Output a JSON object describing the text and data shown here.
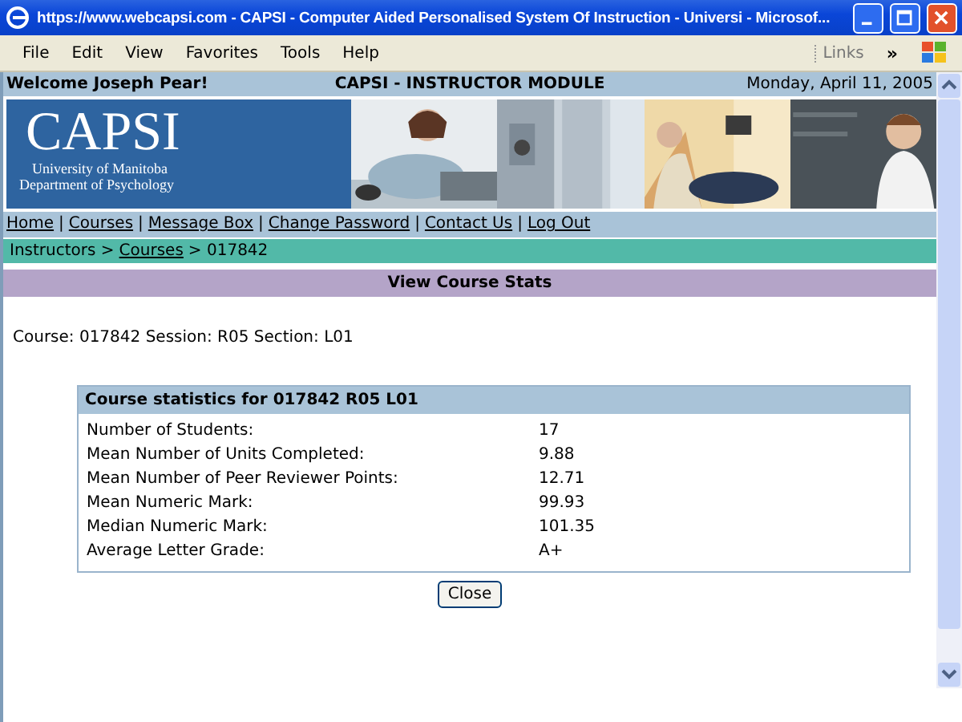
{
  "window": {
    "title": "https://www.webcapsi.com - CAPSI - Computer Aided Personalised System Of Instruction - Universi - Microsof..."
  },
  "menu": [
    "File",
    "Edit",
    "View",
    "Favorites",
    "Tools",
    "Help"
  ],
  "links_toolbar": {
    "label": "Links",
    "chevron": "»"
  },
  "header": {
    "welcome": "Welcome Joseph Pear!",
    "module": "CAPSI - INSTRUCTOR MODULE",
    "date": "Monday, April 11, 2005"
  },
  "banner": {
    "logo": "CAPSI",
    "university": "University of Manitoba",
    "department": "Department of Psychology"
  },
  "nav": {
    "separator": "|",
    "links": [
      "Home",
      "Courses",
      "Message Box",
      "Change Password",
      "Contact Us",
      "Log Out"
    ]
  },
  "breadcrumb": [
    {
      "kind": "text",
      "text": "Instructors >"
    },
    {
      "kind": "link",
      "text": "Courses"
    },
    {
      "kind": "text",
      "text": "> 017842"
    }
  ],
  "section_title": "View Course Stats",
  "course_line": "Course: 017842 Session: R05 Section: L01",
  "stats": {
    "title": "Course statistics for 017842 R05 L01",
    "rows": [
      {
        "label": "Number of Students:",
        "value": "17"
      },
      {
        "label": "Mean Number of Units Completed:",
        "value": "9.88"
      },
      {
        "label": "Mean Number of Peer Reviewer Points:",
        "value": "12.71"
      },
      {
        "label": "Mean Numeric Mark:",
        "value": "99.93"
      },
      {
        "label": "Median Numeric Mark:",
        "value": "101.35"
      },
      {
        "label": "Average Letter Grade:",
        "value": "A+"
      }
    ]
  },
  "buttons": [
    "Close"
  ]
}
